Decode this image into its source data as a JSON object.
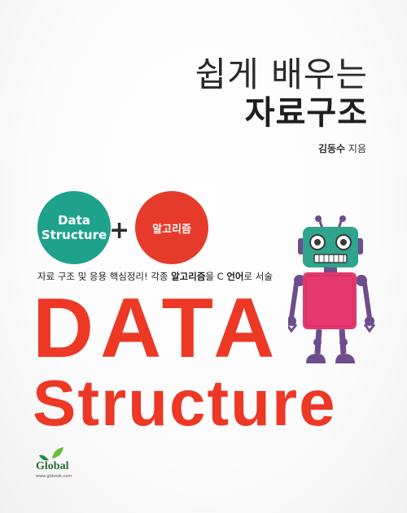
{
  "title": {
    "line1": "쉽게 배우는",
    "line2": "자료구조"
  },
  "author": {
    "name": "김동수",
    "role": "지음"
  },
  "bubbles": {
    "green_line1": "Data",
    "green_line2": "Structure",
    "plus": "+",
    "red": "알고리즘"
  },
  "subtitle": {
    "part1": "자료 구조 및 응용 핵심정리! 각종 ",
    "bold1": "알고리즘",
    "part2": "을 C ",
    "bold2": "언어",
    "part3": "로 서술"
  },
  "headline": {
    "line1": "DATA",
    "line2": "Structure"
  },
  "publisher": {
    "name": "Global",
    "url": "www.gbbook.com"
  },
  "colors": {
    "accent_red": "#ec3825",
    "bubble_green": "#1fa28c",
    "bubble_red": "#e63b2b",
    "robot_head": "#2fa48c",
    "robot_body": "#e4386f",
    "robot_limbs": "#6e4d8c"
  }
}
